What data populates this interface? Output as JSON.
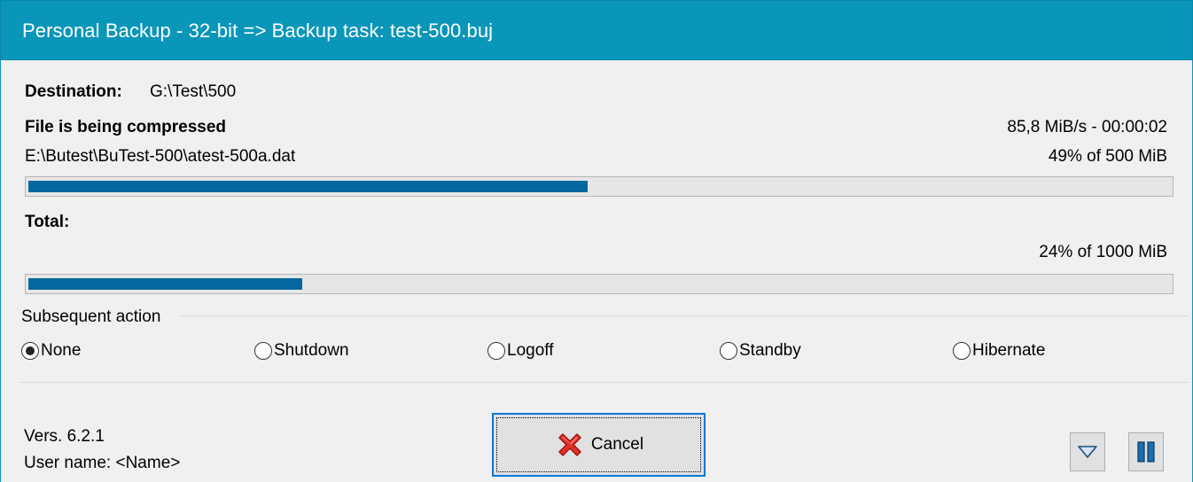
{
  "window": {
    "title": "Personal Backup - 32-bit => Backup task: test-500.buj"
  },
  "destination": {
    "label": "Destination:",
    "value": "G:\\Test\\500"
  },
  "file_progress": {
    "status": "File is being compressed",
    "speed_time": "85,8 MiB/s - 00:00:02",
    "path": "E:\\Butest\\BuTest-500\\atest-500a.dat",
    "percent_text": "49% of 500 MiB",
    "fraction": 0.49
  },
  "total_progress": {
    "label": "Total:",
    "percent_text": "24% of 1000 MiB",
    "fraction": 0.24
  },
  "subsequent_action": {
    "label": "Subsequent action",
    "options": [
      {
        "label": "None",
        "selected": true
      },
      {
        "label": "Shutdown",
        "selected": false
      },
      {
        "label": "Logoff",
        "selected": false
      },
      {
        "label": "Standby",
        "selected": false
      },
      {
        "label": "Hibernate",
        "selected": false
      }
    ]
  },
  "footer": {
    "version": "Vers. 6.2.1",
    "user_name": "User name: <Name>",
    "cancel_label": "Cancel"
  },
  "icons": {
    "cancel": "red-x-icon",
    "expand": "triangle-down-icon",
    "pause": "pause-icon"
  },
  "colors": {
    "titlebar": "#0a96b9",
    "progress_fill": "#06689e"
  }
}
